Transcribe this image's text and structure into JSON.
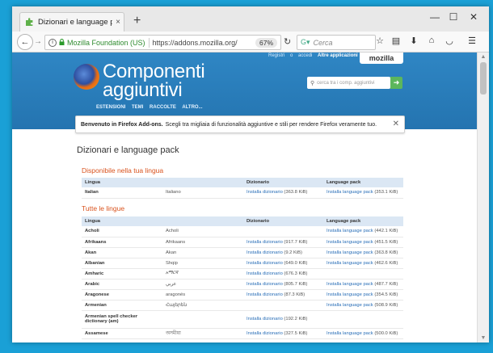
{
  "browser": {
    "tab_title": "Dizionari e language pack ::",
    "tab_close": "×",
    "new_tab": "+",
    "site_identity": "Mozilla Foundation (US)",
    "url": "https://addons.mozilla.org/",
    "zoom": "67%",
    "search_placeholder": "Cerca"
  },
  "window_controls": {
    "minimize": "—",
    "maximize": "☐",
    "close": "✕"
  },
  "hero": {
    "toplinks": [
      "Registri",
      "o",
      "accedi",
      "Altre applicazioni"
    ],
    "mozilla": "mozilla",
    "title_line1": "Componenti",
    "title_line2": "aggiuntivi",
    "nav": [
      "ESTENSIONI",
      "TEMI",
      "RACCOLTE",
      "ALTRO..."
    ],
    "search_placeholder": "cerca tra i comp. aggiuntivi"
  },
  "notice": {
    "bold": "Benvenuto in Firefox Add-ons.",
    "text": "Scegli tra migliaia di funzionalità aggiuntive e stili per rendere Firefox veramente tuo."
  },
  "page_title": "Dizionari e language pack",
  "sections": {
    "available": "Disponibile nella tua lingua",
    "all": "Tutte le lingue"
  },
  "columns": {
    "lang": "Lingua",
    "dict": "Dizionario",
    "pack": "Language pack"
  },
  "available_rows": [
    {
      "lang": "Italian",
      "native": "Italiano",
      "dict": "Installa dizionario",
      "dict_size": "(363.8 KiB)",
      "pack": "Installa language pack",
      "pack_size": "(353.1 KiB)"
    }
  ],
  "all_rows": [
    {
      "lang": "Acholi",
      "native": "Acholi",
      "dict": "",
      "dict_size": "",
      "pack": "Installa language pack",
      "pack_size": "(442.1 KiB)"
    },
    {
      "lang": "Afrikaans",
      "native": "Afrikaans",
      "dict": "Installa dizionario",
      "dict_size": "(917.7 KiB)",
      "pack": "Installa language pack",
      "pack_size": "(451.5 KiB)"
    },
    {
      "lang": "Akan",
      "native": "Akan",
      "dict": "Installa dizionario",
      "dict_size": "(9.2 KiB)",
      "pack": "Installa language pack",
      "pack_size": "(363.8 KiB)"
    },
    {
      "lang": "Albanian",
      "native": "Shqip",
      "dict": "Installa dizionario",
      "dict_size": "(649.0 KiB)",
      "pack": "Installa language pack",
      "pack_size": "(462.6 KiB)"
    },
    {
      "lang": "Amharic",
      "native": "አማርኛ",
      "dict": "Installa dizionario",
      "dict_size": "(676.3 KiB)",
      "pack": "",
      "pack_size": ""
    },
    {
      "lang": "Arabic",
      "native": "عربي",
      "dict": "Installa dizionario",
      "dict_size": "(805.7 KiB)",
      "pack": "Installa language pack",
      "pack_size": "(487.7 KiB)"
    },
    {
      "lang": "Aragonese",
      "native": "aragonés",
      "dict": "Installa dizionario",
      "dict_size": "(87.3 KiB)",
      "pack": "Installa language pack",
      "pack_size": "(354.5 KiB)"
    },
    {
      "lang": "Armenian",
      "native": "Հայերեն",
      "dict": "",
      "dict_size": "",
      "pack": "Installa language pack",
      "pack_size": "(508.9 KiB)"
    },
    {
      "lang": "Armenian spell checker dictionary (am)",
      "native": "",
      "dict": "Installa dizionario",
      "dict_size": "(192.2 KiB)",
      "pack": "",
      "pack_size": ""
    },
    {
      "lang": "Assamese",
      "native": "অসমীয়া",
      "dict": "Installa dizionario",
      "dict_size": "(327.5 KiB)",
      "pack": "Installa language pack",
      "pack_size": "(500.0 KiB)"
    }
  ]
}
